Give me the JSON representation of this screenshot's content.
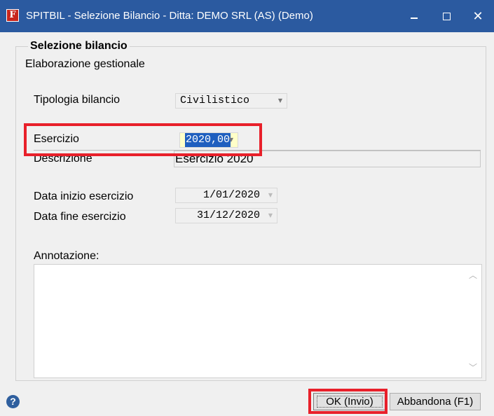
{
  "window": {
    "title": "SPITBIL - Selezione Bilancio - Ditta: DEMO SRL (AS)  (Demo)",
    "icon_letter": "F",
    "minimize_glyph": "",
    "close_glyph": "✕"
  },
  "group": {
    "title": "Selezione bilancio",
    "subtitle": "Elaborazione gestionale"
  },
  "form": {
    "tipologia_label": "Tipologia bilancio",
    "tipologia_value": "Civilistico",
    "esercizio_label": "Esercizio",
    "esercizio_value": "2020,00",
    "descrizione_label": "Descrizione",
    "descrizione_value": "Esercizio 2020",
    "data_inizio_label": "Data inizio esercizio",
    "data_inizio_value": "1/01/2020",
    "data_fine_label": "Data fine esercizio",
    "data_fine_value": "31/12/2020",
    "annotazione_label": "Annotazione:",
    "annotazione_value": ""
  },
  "footer": {
    "help_glyph": "?",
    "ok_label": "OK (Invio)",
    "cancel_label": "Abbandona (F1)"
  },
  "colors": {
    "titlebar": "#2b5aa0",
    "highlight": "#e8202a",
    "selection": "#1f5fbf",
    "esercizio_bg": "#ffffc8"
  }
}
